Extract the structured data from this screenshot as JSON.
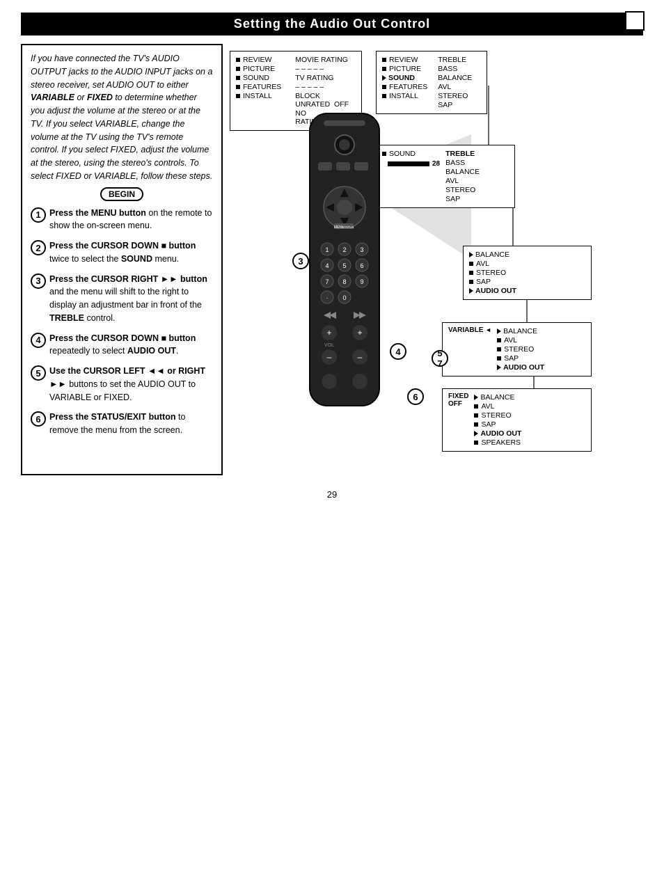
{
  "header": {
    "title": "Setting the Audio Out Control"
  },
  "intro_text": {
    "para1": "If you have connected the TV's AUDIO OUTPUT jacks to the AUDIO INPUT jacks on a stereo receiver, set AUDIO OUT to either VARIABLE or FIXED to determine whether you adjust the volume at the stereo or at the TV. If you select VARIABLE, change the volume at the TV using the TV's remote control. If you select FIXED, adjust the volume at the stereo, using the stereo's controls. To select FIXED or VARIABLE, follow these steps.",
    "begin": "BEGIN"
  },
  "steps": [
    {
      "num": "1",
      "text": "Press the MENU button on the remote to show the on-screen menu."
    },
    {
      "num": "2",
      "text": "Press the CURSOR DOWN ■ button twice to select the SOUND menu."
    },
    {
      "num": "3",
      "text": "Press the CURSOR RIGHT ►► button and the menu will shift to the right to display an adjustment bar in front of the TREBLE control."
    },
    {
      "num": "4",
      "text": "Press the CURSOR DOWN ■ button repeatedly to select AUDIO OUT."
    },
    {
      "num": "5",
      "text": "Use the CURSOR LEFT ◄◄ or RIGHT ►► buttons to set the AUDIO OUT to VARIABLE or FIXED."
    },
    {
      "num": "6",
      "text": "Press the STATUS/EXIT button to remove the menu from the screen."
    }
  ],
  "menus": {
    "box1": {
      "items_left": [
        "REVIEW",
        "PICTURE",
        "SOUND",
        "FEATURES",
        "INSTALL"
      ],
      "title_right": "",
      "items_right": [
        "MOVIE RATING",
        "———————",
        "TV RATING",
        "———————",
        "BLOCK UNRATED  OFF",
        "NO RATING      OFF"
      ]
    },
    "box2": {
      "items_left": [
        "REVIEW",
        "PICTURE",
        "SOUND",
        "FEATURES",
        "INSTALL"
      ],
      "items_right": [
        "",
        "TREBLE",
        "BASS",
        "BALANCE",
        "AVL",
        "STEREO",
        "SAP"
      ]
    },
    "box3": {
      "header": "SOUND",
      "value": "28",
      "items": [
        "TREBLE",
        "BASS",
        "BALANCE",
        "AVL",
        "STEREO",
        "SAP"
      ]
    },
    "box4": {
      "items": [
        "BALANCE",
        "AVL",
        "STEREO",
        "SAP",
        "AUDIO OUT"
      ]
    },
    "box5": {
      "label_left": "VARIABLE",
      "items": [
        "BALANCE",
        "AVL",
        "STEREO",
        "SAP",
        "AUDIO OUT"
      ]
    },
    "box6": {
      "label_left1": "FIXED",
      "label_left2": "OFF",
      "items": [
        "BALANCE",
        "AVL",
        "STEREO",
        "SAP",
        "AUDIO OUT",
        "SPEAKERS"
      ]
    }
  },
  "page_number": "29"
}
